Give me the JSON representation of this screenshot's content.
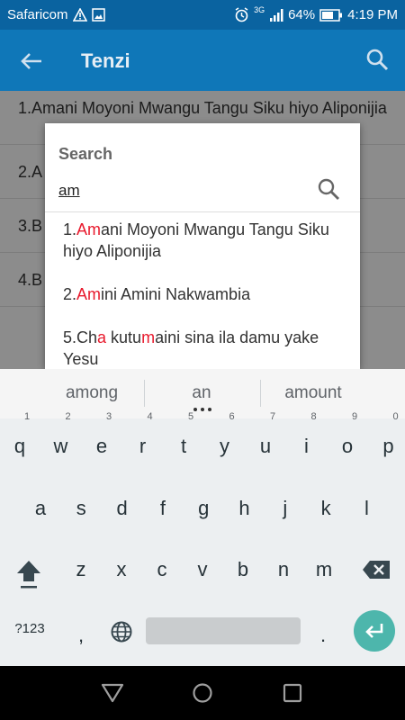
{
  "status_bar": {
    "carrier": "Safaricom",
    "network": "3G",
    "battery": "64%",
    "time": "4:19 PM"
  },
  "app_bar": {
    "title": "Tenzi"
  },
  "list": {
    "items": [
      {
        "label": "1.Amani Moyoni Mwangu Tangu Siku hiyo Aliponijia"
      },
      {
        "label": "2.A"
      },
      {
        "label": "3.B"
      },
      {
        "label": "4.B"
      }
    ]
  },
  "search_dialog": {
    "title": "Search",
    "query": "am",
    "results": [
      {
        "parts": [
          {
            "t": "1."
          },
          {
            "t": "Am",
            "h": true
          },
          {
            "t": "ani Moyoni Mwangu Tangu Siku hiyo Aliponijia"
          }
        ]
      },
      {
        "parts": [
          {
            "t": "2."
          },
          {
            "t": "Am",
            "h": true
          },
          {
            "t": "ini Amini Nakwambia"
          }
        ]
      },
      {
        "parts": [
          {
            "t": "5.Ch"
          },
          {
            "t": "a",
            "h": true
          },
          {
            "t": " kutu"
          },
          {
            "t": "m",
            "h": true
          },
          {
            "t": "aini sina ila damu yake Yesu"
          }
        ]
      }
    ]
  },
  "keyboard": {
    "suggestions": [
      "among",
      "an",
      "amount"
    ],
    "row1": [
      {
        "k": "q",
        "n": "1"
      },
      {
        "k": "w",
        "n": "2"
      },
      {
        "k": "e",
        "n": "3"
      },
      {
        "k": "r",
        "n": "4"
      },
      {
        "k": "t",
        "n": "5"
      },
      {
        "k": "y",
        "n": "6"
      },
      {
        "k": "u",
        "n": "7"
      },
      {
        "k": "i",
        "n": "8"
      },
      {
        "k": "o",
        "n": "9"
      },
      {
        "k": "p",
        "n": "0"
      }
    ],
    "row2": [
      "a",
      "s",
      "d",
      "f",
      "g",
      "h",
      "j",
      "k",
      "l"
    ],
    "row3": [
      "z",
      "x",
      "c",
      "v",
      "b",
      "n",
      "m"
    ],
    "symbols_label": "?123",
    "comma": ",",
    "period": "."
  },
  "colors": {
    "app_bar": "#0f77b8",
    "status_bar": "#0a63a0",
    "highlight": "#e8192c",
    "enter_key": "#4db6ac"
  },
  "icons": [
    "back-arrow-icon",
    "search-icon",
    "warning-icon",
    "image-icon",
    "alarm-icon",
    "signal-icon",
    "battery-icon",
    "globe-icon",
    "shift-icon",
    "backspace-icon",
    "enter-icon",
    "nav-back-icon",
    "nav-home-icon",
    "nav-recents-icon"
  ]
}
